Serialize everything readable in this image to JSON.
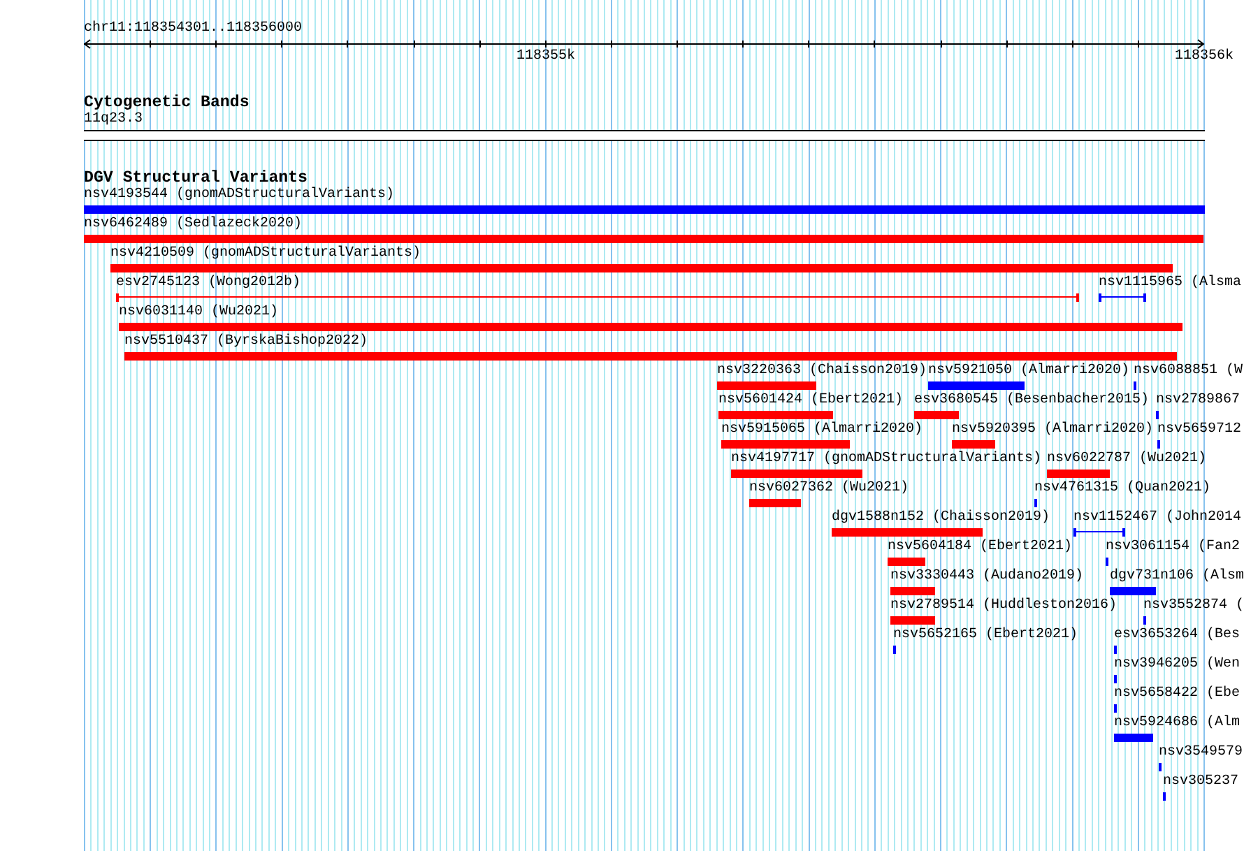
{
  "location": "chr11:118354301..118356000",
  "ruler": {
    "labels": [
      "118355k",
      "118356k"
    ]
  },
  "tracks": [
    {
      "title": "Cytogenetic Bands",
      "bands": [
        {
          "label": "11q23.3"
        }
      ]
    },
    {
      "title": "DGV Structural Variants",
      "features": [
        {
          "label": "nsv4193544 (gnomADStructuralVariants)",
          "kind": "bar",
          "color": "#0000ff"
        },
        {
          "label": "nsv6462489 (Sedlazeck2020)",
          "kind": "bar",
          "color": "#ff0000"
        },
        {
          "label": "nsv4210509 (gnomADStructuralVariants)",
          "kind": "bar",
          "color": "#ff0000"
        },
        {
          "label": "esv2745123 (Wong2012b)",
          "kind": "interval",
          "color": "#ff0000"
        },
        {
          "label": "nsv1115965 (Alsma",
          "kind": "interval",
          "color": "#0000ff"
        },
        {
          "label": "nsv6031140 (Wu2021)",
          "kind": "bar",
          "color": "#ff0000"
        },
        {
          "label": "nsv5510437 (ByrskaBishop2022)",
          "kind": "bar",
          "color": "#ff0000"
        },
        {
          "label": "nsv3220363 (Chaisson2019)",
          "kind": "bar",
          "color": "#ff0000"
        },
        {
          "label": "nsv5921050 (Almarri2020)",
          "kind": "bar",
          "color": "#0000ff"
        },
        {
          "label": "nsv6088851 (W",
          "kind": "bar",
          "color": "#0000ff"
        },
        {
          "label": "nsv5601424 (Ebert2021)",
          "kind": "bar",
          "color": "#ff0000"
        },
        {
          "label": "esv3680545 (Besenbacher2015)",
          "kind": "bar",
          "color": "#ff0000"
        },
        {
          "label": "nsv2789867",
          "kind": "bar",
          "color": "#0000ff"
        },
        {
          "label": "nsv5915065 (Almarri2020)",
          "kind": "bar",
          "color": "#ff0000"
        },
        {
          "label": "nsv5920395 (Almarri2020)",
          "kind": "bar",
          "color": "#ff0000"
        },
        {
          "label": "nsv5659712",
          "kind": "bar",
          "color": "#0000ff"
        },
        {
          "label": "nsv4197717 (gnomADStructuralVariants)",
          "kind": "bar",
          "color": "#ff0000"
        },
        {
          "label": "nsv6022787 (Wu2021)",
          "kind": "bar",
          "color": "#ff0000"
        },
        {
          "label": "nsv6027362 (Wu2021)",
          "kind": "bar",
          "color": "#ff0000"
        },
        {
          "label": "nsv4761315 (Quan2021)",
          "kind": "bar",
          "color": "#0000ff"
        },
        {
          "label": "dgv1588n152 (Chaisson2019)",
          "kind": "bar",
          "color": "#ff0000"
        },
        {
          "label": "nsv1152467 (John2014",
          "kind": "interval",
          "color": "#0000ff"
        },
        {
          "label": "nsv5604184 (Ebert2021)",
          "kind": "bar",
          "color": "#ff0000"
        },
        {
          "label": "nsv3061154 (Fan2",
          "kind": "bar",
          "color": "#0000ff"
        },
        {
          "label": "nsv3330443 (Audano2019)",
          "kind": "bar",
          "color": "#ff0000"
        },
        {
          "label": "dgv731n106 (Alsm",
          "kind": "bar",
          "color": "#0000ff"
        },
        {
          "label": "nsv2789514 (Huddleston2016)",
          "kind": "bar",
          "color": "#ff0000"
        },
        {
          "label": "nsv3552874 (",
          "kind": "bar",
          "color": "#0000ff"
        },
        {
          "label": "nsv5652165 (Ebert2021)",
          "kind": "bar",
          "color": "#0000ff"
        },
        {
          "label": "esv3653264 (Bes",
          "kind": "bar",
          "color": "#0000ff"
        },
        {
          "label": "nsv3946205 (Wen",
          "kind": "bar",
          "color": "#0000ff"
        },
        {
          "label": "nsv5658422 (Ebe",
          "kind": "bar",
          "color": "#0000ff"
        },
        {
          "label": "nsv5924686 (Alm",
          "kind": "bar",
          "color": "#0000ff"
        },
        {
          "label": "nsv3549579",
          "kind": "bar",
          "color": "#0000ff"
        },
        {
          "label": "nsv305237",
          "kind": "bar",
          "color": "#0000ff"
        }
      ]
    }
  ]
}
